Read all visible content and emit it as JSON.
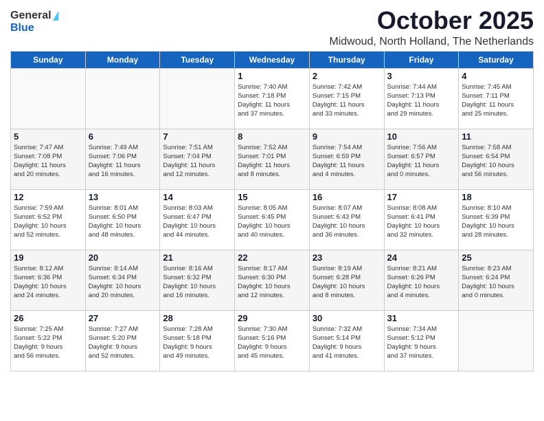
{
  "header": {
    "logo_general": "General",
    "logo_blue": "Blue",
    "month_title": "October 2025",
    "location": "Midwoud, North Holland, The Netherlands"
  },
  "days_of_week": [
    "Sunday",
    "Monday",
    "Tuesday",
    "Wednesday",
    "Thursday",
    "Friday",
    "Saturday"
  ],
  "weeks": [
    [
      {
        "day": "",
        "info": ""
      },
      {
        "day": "",
        "info": ""
      },
      {
        "day": "",
        "info": ""
      },
      {
        "day": "1",
        "info": "Sunrise: 7:40 AM\nSunset: 7:18 PM\nDaylight: 11 hours\nand 37 minutes."
      },
      {
        "day": "2",
        "info": "Sunrise: 7:42 AM\nSunset: 7:15 PM\nDaylight: 11 hours\nand 33 minutes."
      },
      {
        "day": "3",
        "info": "Sunrise: 7:44 AM\nSunset: 7:13 PM\nDaylight: 11 hours\nand 29 minutes."
      },
      {
        "day": "4",
        "info": "Sunrise: 7:45 AM\nSunset: 7:11 PM\nDaylight: 11 hours\nand 25 minutes."
      }
    ],
    [
      {
        "day": "5",
        "info": "Sunrise: 7:47 AM\nSunset: 7:08 PM\nDaylight: 11 hours\nand 20 minutes."
      },
      {
        "day": "6",
        "info": "Sunrise: 7:49 AM\nSunset: 7:06 PM\nDaylight: 11 hours\nand 16 minutes."
      },
      {
        "day": "7",
        "info": "Sunrise: 7:51 AM\nSunset: 7:04 PM\nDaylight: 11 hours\nand 12 minutes."
      },
      {
        "day": "8",
        "info": "Sunrise: 7:52 AM\nSunset: 7:01 PM\nDaylight: 11 hours\nand 8 minutes."
      },
      {
        "day": "9",
        "info": "Sunrise: 7:54 AM\nSunset: 6:59 PM\nDaylight: 11 hours\nand 4 minutes."
      },
      {
        "day": "10",
        "info": "Sunrise: 7:56 AM\nSunset: 6:57 PM\nDaylight: 11 hours\nand 0 minutes."
      },
      {
        "day": "11",
        "info": "Sunrise: 7:58 AM\nSunset: 6:54 PM\nDaylight: 10 hours\nand 56 minutes."
      }
    ],
    [
      {
        "day": "12",
        "info": "Sunrise: 7:59 AM\nSunset: 6:52 PM\nDaylight: 10 hours\nand 52 minutes."
      },
      {
        "day": "13",
        "info": "Sunrise: 8:01 AM\nSunset: 6:50 PM\nDaylight: 10 hours\nand 48 minutes."
      },
      {
        "day": "14",
        "info": "Sunrise: 8:03 AM\nSunset: 6:47 PM\nDaylight: 10 hours\nand 44 minutes."
      },
      {
        "day": "15",
        "info": "Sunrise: 8:05 AM\nSunset: 6:45 PM\nDaylight: 10 hours\nand 40 minutes."
      },
      {
        "day": "16",
        "info": "Sunrise: 8:07 AM\nSunset: 6:43 PM\nDaylight: 10 hours\nand 36 minutes."
      },
      {
        "day": "17",
        "info": "Sunrise: 8:08 AM\nSunset: 6:41 PM\nDaylight: 10 hours\nand 32 minutes."
      },
      {
        "day": "18",
        "info": "Sunrise: 8:10 AM\nSunset: 6:39 PM\nDaylight: 10 hours\nand 28 minutes."
      }
    ],
    [
      {
        "day": "19",
        "info": "Sunrise: 8:12 AM\nSunset: 6:36 PM\nDaylight: 10 hours\nand 24 minutes."
      },
      {
        "day": "20",
        "info": "Sunrise: 8:14 AM\nSunset: 6:34 PM\nDaylight: 10 hours\nand 20 minutes."
      },
      {
        "day": "21",
        "info": "Sunrise: 8:16 AM\nSunset: 6:32 PM\nDaylight: 10 hours\nand 16 minutes."
      },
      {
        "day": "22",
        "info": "Sunrise: 8:17 AM\nSunset: 6:30 PM\nDaylight: 10 hours\nand 12 minutes."
      },
      {
        "day": "23",
        "info": "Sunrise: 8:19 AM\nSunset: 6:28 PM\nDaylight: 10 hours\nand 8 minutes."
      },
      {
        "day": "24",
        "info": "Sunrise: 8:21 AM\nSunset: 6:26 PM\nDaylight: 10 hours\nand 4 minutes."
      },
      {
        "day": "25",
        "info": "Sunrise: 8:23 AM\nSunset: 6:24 PM\nDaylight: 10 hours\nand 0 minutes."
      }
    ],
    [
      {
        "day": "26",
        "info": "Sunrise: 7:25 AM\nSunset: 5:22 PM\nDaylight: 9 hours\nand 56 minutes."
      },
      {
        "day": "27",
        "info": "Sunrise: 7:27 AM\nSunset: 5:20 PM\nDaylight: 9 hours\nand 52 minutes."
      },
      {
        "day": "28",
        "info": "Sunrise: 7:28 AM\nSunset: 5:18 PM\nDaylight: 9 hours\nand 49 minutes."
      },
      {
        "day": "29",
        "info": "Sunrise: 7:30 AM\nSunset: 5:16 PM\nDaylight: 9 hours\nand 45 minutes."
      },
      {
        "day": "30",
        "info": "Sunrise: 7:32 AM\nSunset: 5:14 PM\nDaylight: 9 hours\nand 41 minutes."
      },
      {
        "day": "31",
        "info": "Sunrise: 7:34 AM\nSunset: 5:12 PM\nDaylight: 9 hours\nand 37 minutes."
      },
      {
        "day": "",
        "info": ""
      }
    ]
  ]
}
